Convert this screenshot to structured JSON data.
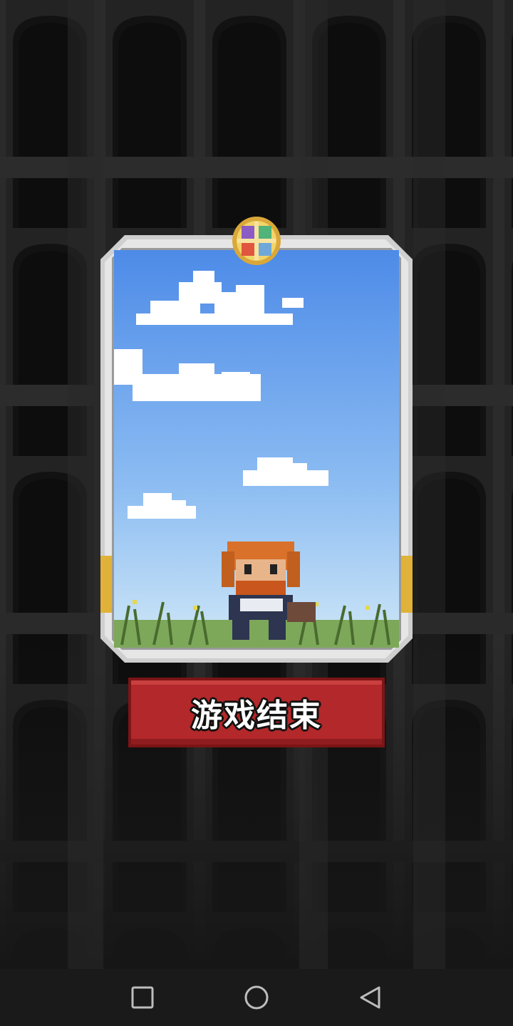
{
  "game": {
    "end_button_label": "游戏结束"
  },
  "card": {
    "emblem_icon": "compass-emblem-icon",
    "character_icon": "bearded-warrior-icon"
  },
  "navbar": {
    "recent_icon": "square-icon",
    "home_icon": "circle-icon",
    "back_icon": "triangle-back-icon"
  },
  "colors": {
    "background": "#1c1c1c",
    "sky_top": "#4d8be8",
    "sky_bottom": "#cfe7f7",
    "button_red": "#b3282a",
    "card_border": "#d8d8d8"
  }
}
